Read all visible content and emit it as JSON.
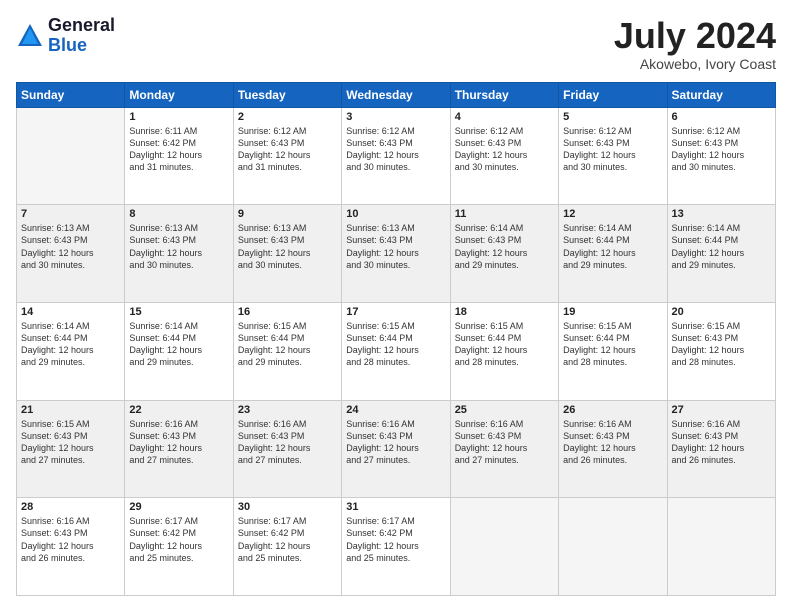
{
  "logo": {
    "general": "General",
    "blue": "Blue"
  },
  "title": {
    "month_year": "July 2024",
    "location": "Akowebo, Ivory Coast"
  },
  "calendar": {
    "headers": [
      "Sunday",
      "Monday",
      "Tuesday",
      "Wednesday",
      "Thursday",
      "Friday",
      "Saturday"
    ],
    "weeks": [
      [
        {
          "day": "",
          "info": ""
        },
        {
          "day": "1",
          "info": "Sunrise: 6:11 AM\nSunset: 6:42 PM\nDaylight: 12 hours\nand 31 minutes."
        },
        {
          "day": "2",
          "info": "Sunrise: 6:12 AM\nSunset: 6:43 PM\nDaylight: 12 hours\nand 31 minutes."
        },
        {
          "day": "3",
          "info": "Sunrise: 6:12 AM\nSunset: 6:43 PM\nDaylight: 12 hours\nand 30 minutes."
        },
        {
          "day": "4",
          "info": "Sunrise: 6:12 AM\nSunset: 6:43 PM\nDaylight: 12 hours\nand 30 minutes."
        },
        {
          "day": "5",
          "info": "Sunrise: 6:12 AM\nSunset: 6:43 PM\nDaylight: 12 hours\nand 30 minutes."
        },
        {
          "day": "6",
          "info": "Sunrise: 6:12 AM\nSunset: 6:43 PM\nDaylight: 12 hours\nand 30 minutes."
        }
      ],
      [
        {
          "day": "7",
          "info": "Sunrise: 6:13 AM\nSunset: 6:43 PM\nDaylight: 12 hours\nand 30 minutes."
        },
        {
          "day": "8",
          "info": "Sunrise: 6:13 AM\nSunset: 6:43 PM\nDaylight: 12 hours\nand 30 minutes."
        },
        {
          "day": "9",
          "info": "Sunrise: 6:13 AM\nSunset: 6:43 PM\nDaylight: 12 hours\nand 30 minutes."
        },
        {
          "day": "10",
          "info": "Sunrise: 6:13 AM\nSunset: 6:43 PM\nDaylight: 12 hours\nand 30 minutes."
        },
        {
          "day": "11",
          "info": "Sunrise: 6:14 AM\nSunset: 6:43 PM\nDaylight: 12 hours\nand 29 minutes."
        },
        {
          "day": "12",
          "info": "Sunrise: 6:14 AM\nSunset: 6:44 PM\nDaylight: 12 hours\nand 29 minutes."
        },
        {
          "day": "13",
          "info": "Sunrise: 6:14 AM\nSunset: 6:44 PM\nDaylight: 12 hours\nand 29 minutes."
        }
      ],
      [
        {
          "day": "14",
          "info": "Sunrise: 6:14 AM\nSunset: 6:44 PM\nDaylight: 12 hours\nand 29 minutes."
        },
        {
          "day": "15",
          "info": "Sunrise: 6:14 AM\nSunset: 6:44 PM\nDaylight: 12 hours\nand 29 minutes."
        },
        {
          "day": "16",
          "info": "Sunrise: 6:15 AM\nSunset: 6:44 PM\nDaylight: 12 hours\nand 29 minutes."
        },
        {
          "day": "17",
          "info": "Sunrise: 6:15 AM\nSunset: 6:44 PM\nDaylight: 12 hours\nand 28 minutes."
        },
        {
          "day": "18",
          "info": "Sunrise: 6:15 AM\nSunset: 6:44 PM\nDaylight: 12 hours\nand 28 minutes."
        },
        {
          "day": "19",
          "info": "Sunrise: 6:15 AM\nSunset: 6:44 PM\nDaylight: 12 hours\nand 28 minutes."
        },
        {
          "day": "20",
          "info": "Sunrise: 6:15 AM\nSunset: 6:43 PM\nDaylight: 12 hours\nand 28 minutes."
        }
      ],
      [
        {
          "day": "21",
          "info": "Sunrise: 6:15 AM\nSunset: 6:43 PM\nDaylight: 12 hours\nand 27 minutes."
        },
        {
          "day": "22",
          "info": "Sunrise: 6:16 AM\nSunset: 6:43 PM\nDaylight: 12 hours\nand 27 minutes."
        },
        {
          "day": "23",
          "info": "Sunrise: 6:16 AM\nSunset: 6:43 PM\nDaylight: 12 hours\nand 27 minutes."
        },
        {
          "day": "24",
          "info": "Sunrise: 6:16 AM\nSunset: 6:43 PM\nDaylight: 12 hours\nand 27 minutes."
        },
        {
          "day": "25",
          "info": "Sunrise: 6:16 AM\nSunset: 6:43 PM\nDaylight: 12 hours\nand 27 minutes."
        },
        {
          "day": "26",
          "info": "Sunrise: 6:16 AM\nSunset: 6:43 PM\nDaylight: 12 hours\nand 26 minutes."
        },
        {
          "day": "27",
          "info": "Sunrise: 6:16 AM\nSunset: 6:43 PM\nDaylight: 12 hours\nand 26 minutes."
        }
      ],
      [
        {
          "day": "28",
          "info": "Sunrise: 6:16 AM\nSunset: 6:43 PM\nDaylight: 12 hours\nand 26 minutes."
        },
        {
          "day": "29",
          "info": "Sunrise: 6:17 AM\nSunset: 6:42 PM\nDaylight: 12 hours\nand 25 minutes."
        },
        {
          "day": "30",
          "info": "Sunrise: 6:17 AM\nSunset: 6:42 PM\nDaylight: 12 hours\nand 25 minutes."
        },
        {
          "day": "31",
          "info": "Sunrise: 6:17 AM\nSunset: 6:42 PM\nDaylight: 12 hours\nand 25 minutes."
        },
        {
          "day": "",
          "info": ""
        },
        {
          "day": "",
          "info": ""
        },
        {
          "day": "",
          "info": ""
        }
      ]
    ]
  }
}
